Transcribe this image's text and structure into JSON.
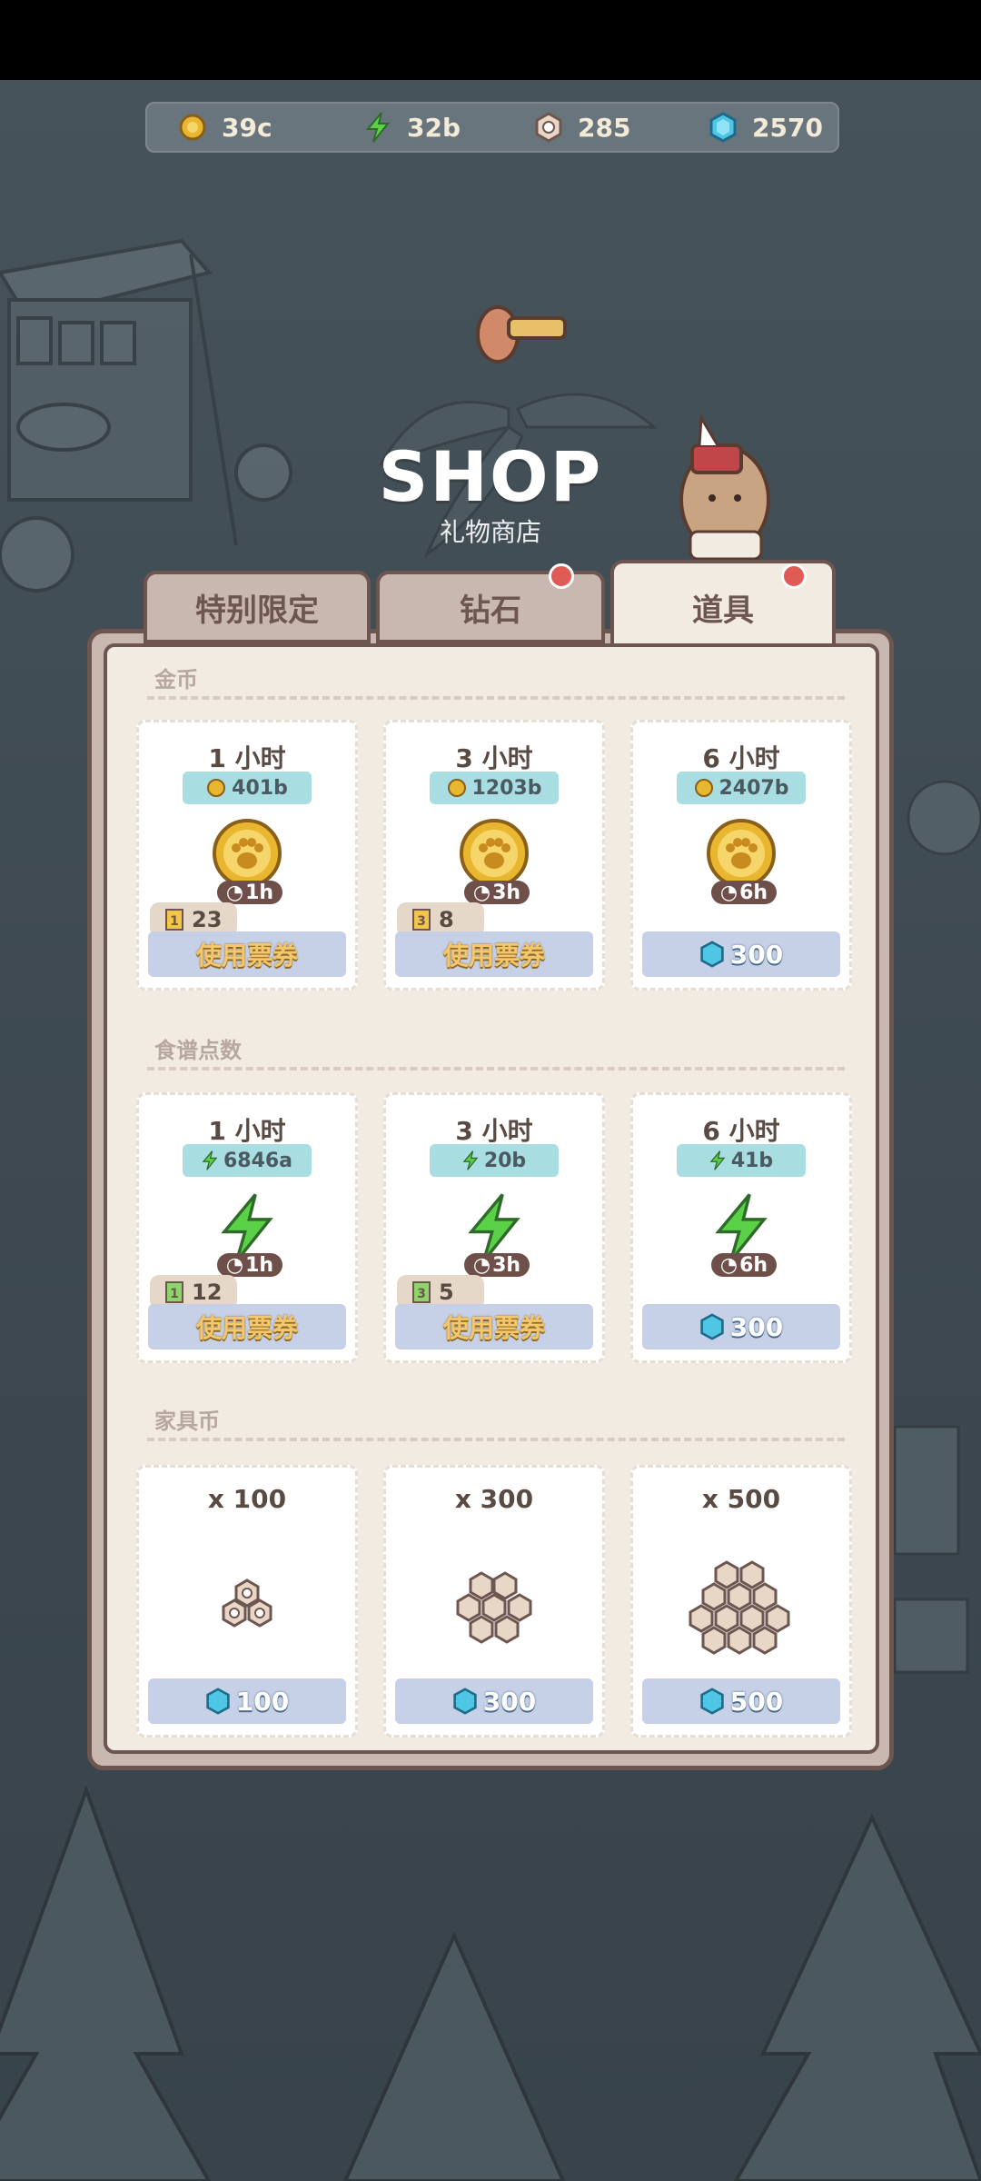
{
  "resources": [
    {
      "icon": "coin-icon",
      "value": "39c"
    },
    {
      "icon": "lightning-icon",
      "value": "32b"
    },
    {
      "icon": "nut-icon",
      "value": "285"
    },
    {
      "icon": "gem-icon",
      "value": "2570"
    }
  ],
  "header": {
    "title": "SHOP",
    "subtitle": "礼物商店"
  },
  "tabs": [
    {
      "label": "特别限定",
      "badge": false,
      "active": false
    },
    {
      "label": "钻石",
      "badge": true,
      "active": false
    },
    {
      "label": "道具",
      "badge": true,
      "active": true
    }
  ],
  "sections": [
    {
      "title": "金币",
      "items": [
        {
          "duration": "1 小时",
          "amount": "401b",
          "tag": "1h",
          "ticket_count": "23",
          "ticket_level": "1",
          "button": "使用票券"
        },
        {
          "duration": "3 小时",
          "amount": "1203b",
          "tag": "3h",
          "ticket_count": "8",
          "ticket_level": "3",
          "button": "使用票券"
        },
        {
          "duration": "6 小时",
          "amount": "2407b",
          "tag": "6h",
          "button": "300"
        }
      ]
    },
    {
      "title": "食谱点数",
      "items": [
        {
          "duration": "1 小时",
          "amount": "6846a",
          "tag": "1h",
          "ticket_count": "12",
          "ticket_level": "1",
          "button": "使用票券"
        },
        {
          "duration": "3 小时",
          "amount": "20b",
          "tag": "3h",
          "ticket_count": "5",
          "ticket_level": "3",
          "button": "使用票券"
        },
        {
          "duration": "6 小时",
          "amount": "41b",
          "tag": "6h",
          "button": "300"
        }
      ]
    },
    {
      "title": "家具币",
      "items": [
        {
          "quantity": "x 100",
          "button": "100"
        },
        {
          "quantity": "x 300",
          "button": "300"
        },
        {
          "quantity": "x 500",
          "button": "500"
        }
      ]
    }
  ],
  "colors": {
    "accent": "#6e5650",
    "gem": "#4fc6e6",
    "coin": "#e9b72f",
    "lightning": "#5bd148"
  }
}
